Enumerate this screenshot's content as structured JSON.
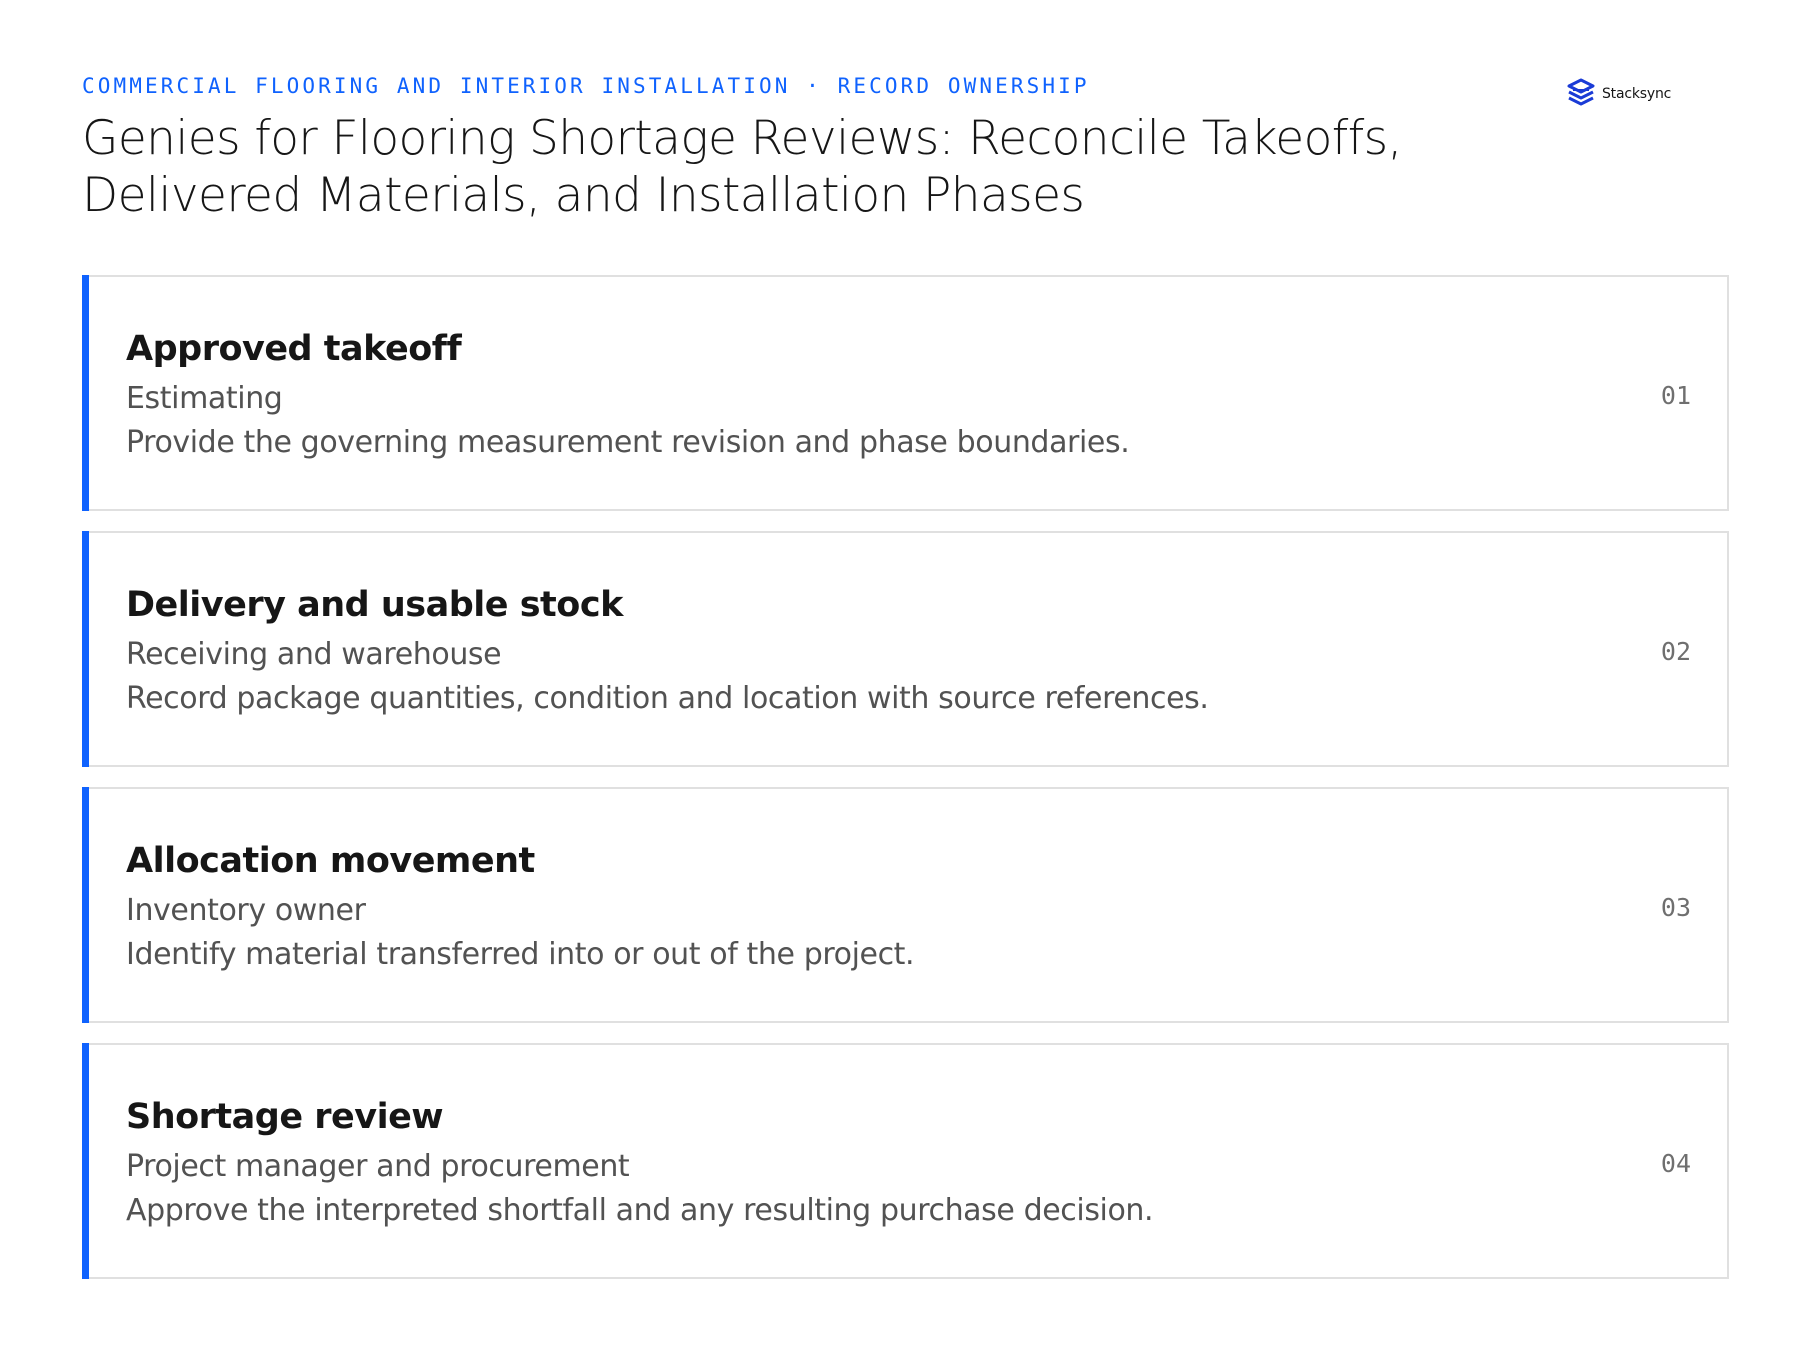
{
  "header": {
    "eyebrow": "COMMERCIAL FLOORING AND INTERIOR INSTALLATION · RECORD OWNERSHIP",
    "title_line1": "Genies for Flooring Shortage Reviews: Reconcile Takeoffs,",
    "title_line2": "Delivered Materials, and Installation Phases"
  },
  "logo": {
    "text": "Stacksync",
    "icon": "stacksync-logo-icon",
    "color": "#1a3bd6"
  },
  "colors": {
    "accent": "#0f62fe",
    "border": "#e0e0e0",
    "secondary_text": "#525252"
  },
  "cards": [
    {
      "number": "01",
      "title": "Approved takeoff",
      "role": "Estimating",
      "description": "Provide the governing measurement revision and phase boundaries."
    },
    {
      "number": "02",
      "title": "Delivery and usable stock",
      "role": "Receiving and warehouse",
      "description": "Record package quantities, condition and location with source references."
    },
    {
      "number": "03",
      "title": "Allocation movement",
      "role": "Inventory owner",
      "description": "Identify material transferred into or out of the project."
    },
    {
      "number": "04",
      "title": "Shortage review",
      "role": "Project manager and procurement",
      "description": "Approve the interpreted shortfall and any resulting purchase decision."
    }
  ]
}
